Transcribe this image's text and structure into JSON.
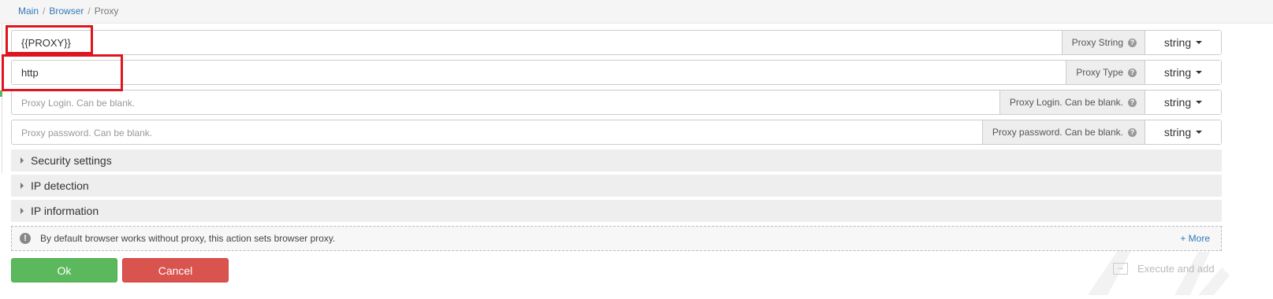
{
  "breadcrumb": {
    "main": "Main",
    "sep1": "/",
    "browser": "Browser",
    "sep2": "/",
    "current": "Proxy"
  },
  "fields": {
    "proxy_string": {
      "value": "{{PROXY}}",
      "label": "Proxy String",
      "type": "string"
    },
    "proxy_type": {
      "value": "http",
      "label": "Proxy Type",
      "type": "string"
    },
    "proxy_login": {
      "placeholder": "Proxy Login. Can be blank.",
      "label": "Proxy Login. Can be blank.",
      "type": "string"
    },
    "proxy_password": {
      "placeholder": "Proxy password. Can be blank.",
      "label": "Proxy password. Can be blank.",
      "type": "string"
    }
  },
  "help_glyph": "?",
  "sections": {
    "security": "Security settings",
    "ip_detection": "IP detection",
    "ip_information": "IP information"
  },
  "info": {
    "icon_glyph": "!",
    "text": "By default browser works without proxy, this action sets browser proxy.",
    "more": "+ More"
  },
  "buttons": {
    "ok": "Ok",
    "cancel": "Cancel",
    "execute_add": "Execute and add"
  },
  "colors": {
    "ok": "#5cb85c",
    "cancel": "#d9534f",
    "highlight": "#e0141e",
    "link": "#337ab7"
  }
}
